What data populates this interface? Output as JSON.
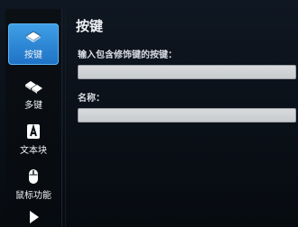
{
  "sidebar": {
    "items": [
      {
        "label": "按键",
        "icon": "key-icon",
        "active": true
      },
      {
        "label": "多键",
        "icon": "multi-key-icon",
        "active": false
      },
      {
        "label": "文本块",
        "icon": "text-block-icon",
        "active": false
      },
      {
        "label": "鼠标功能",
        "icon": "mouse-icon",
        "active": false
      },
      {
        "label": "",
        "icon": "play-icon",
        "active": false
      }
    ]
  },
  "main": {
    "title": "按键",
    "key_field": {
      "label": "输入包含修饰键的按键：",
      "value": ""
    },
    "name_field": {
      "label": "名称：",
      "value": ""
    }
  },
  "colors": {
    "accent": "#2a86d8",
    "background": "#0a1018",
    "field": "#cfd2d5"
  }
}
